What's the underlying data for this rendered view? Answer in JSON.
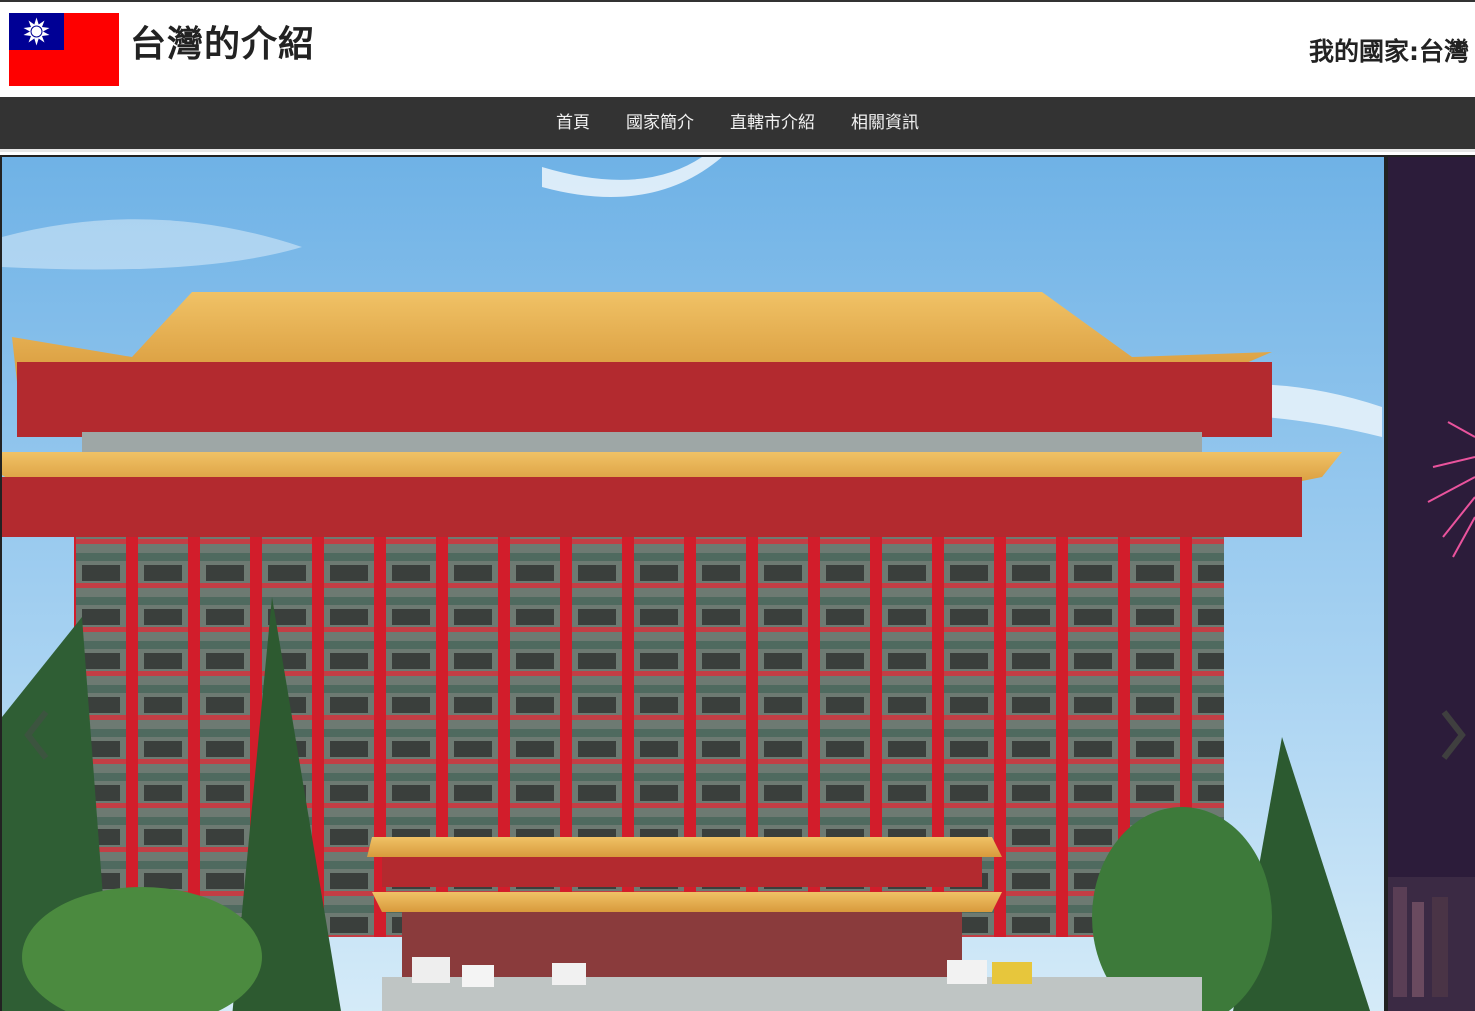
{
  "site": {
    "title": "台灣的介紹",
    "country_tag": "我的國家:台灣",
    "flag_icon": "taiwan-flag-icon"
  },
  "nav": {
    "items": [
      {
        "label": "首頁"
      },
      {
        "label": "國家簡介"
      },
      {
        "label": "直轄市介紹"
      },
      {
        "label": "相關資訊"
      }
    ]
  },
  "carousel": {
    "prev_icon": "chevron-left-icon",
    "next_icon": "chevron-right-icon",
    "slides": [
      {
        "subject": "grand-hotel-image"
      },
      {
        "subject": "fireworks-image"
      }
    ]
  },
  "colors": {
    "navbar": "#333333",
    "flag_red": "#fe0000",
    "flag_blue": "#000095"
  }
}
